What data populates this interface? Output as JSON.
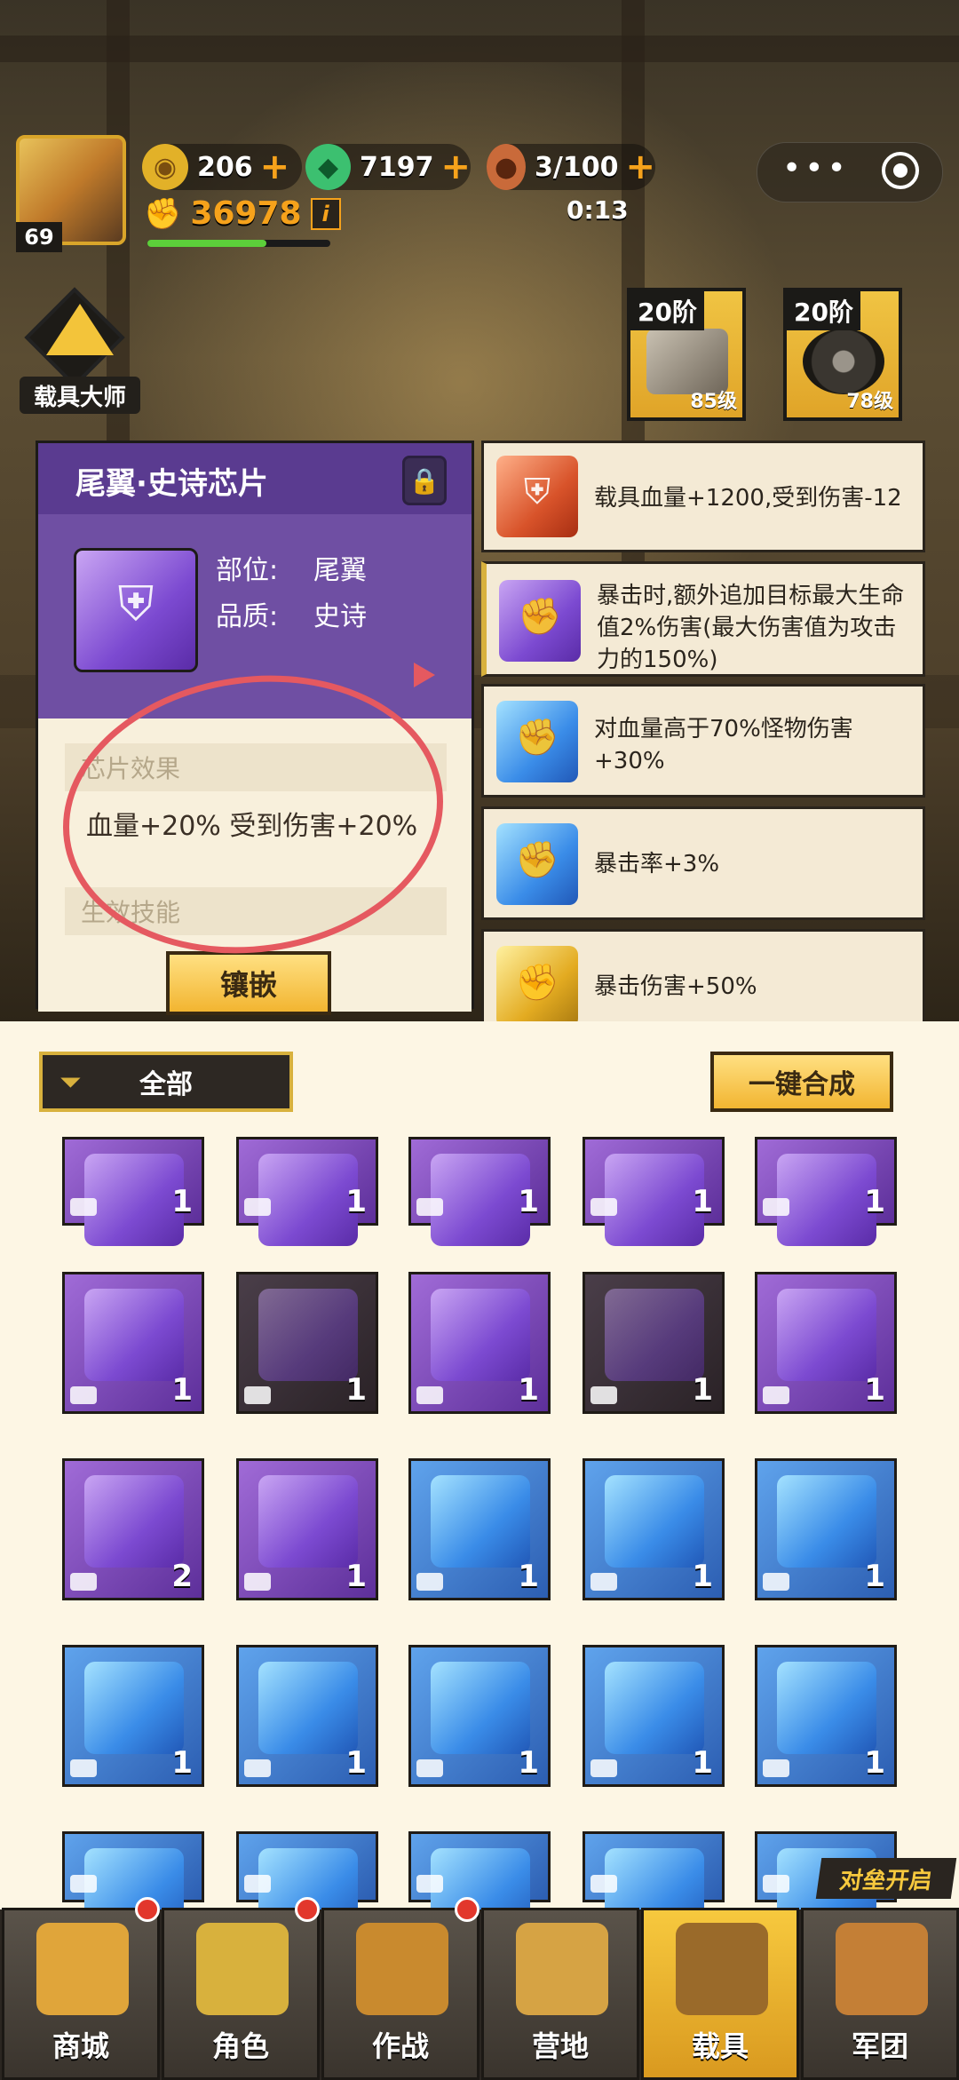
{
  "player": {
    "level": "69",
    "power": "36978",
    "power_info": "i",
    "xp_fraction": 0.65
  },
  "resources": {
    "coins": "206",
    "gems": "7197",
    "energy": "3/100",
    "energy_timer": "0:13"
  },
  "vehicle_master": {
    "label": "载具大师"
  },
  "parts": [
    {
      "tier": "20阶",
      "level": "85级",
      "name": "engine"
    },
    {
      "tier": "20阶",
      "level": "78级",
      "name": "wheel"
    }
  ],
  "detail": {
    "title": "尾翼·史诗芯片",
    "position_label": "部位:",
    "position_value": "尾翼",
    "quality_label": "品质:",
    "quality_value": "史诗",
    "effect_header": "芯片效果",
    "effect_text": "血量+20% 受到伤害+20%",
    "skill_header": "生效技能",
    "inlay_button": "镶嵌"
  },
  "skills": [
    {
      "text": "载具血量+1200,受到伤害-12",
      "color": "red"
    },
    {
      "text": "暴击时,额外追加目标最大生命值2%伤害(最大伤害值为攻击力的150%)",
      "color": "purple"
    },
    {
      "text": "对血量高于70%怪物伤害+30%",
      "color": "blue"
    },
    {
      "text": "暴击率+3%",
      "color": "blue"
    },
    {
      "text": "暴击伤害+50%",
      "color": "gold"
    }
  ],
  "inventory": {
    "filter_label": "全部",
    "merge_button": "一键合成",
    "rows": [
      [
        {
          "c": "1",
          "t": "p"
        },
        {
          "c": "1",
          "t": "p"
        },
        {
          "c": "1",
          "t": "p"
        },
        {
          "c": "1",
          "t": "p"
        },
        {
          "c": "1",
          "t": "p"
        }
      ],
      [
        {
          "c": "1",
          "t": "p"
        },
        {
          "c": "1",
          "t": "d"
        },
        {
          "c": "1",
          "t": "p"
        },
        {
          "c": "1",
          "t": "d"
        },
        {
          "c": "1",
          "t": "p"
        }
      ],
      [
        {
          "c": "2",
          "t": "p"
        },
        {
          "c": "1",
          "t": "p"
        },
        {
          "c": "1",
          "t": "b"
        },
        {
          "c": "1",
          "t": "b"
        },
        {
          "c": "1",
          "t": "b"
        }
      ],
      [
        {
          "c": "1",
          "t": "b"
        },
        {
          "c": "1",
          "t": "b"
        },
        {
          "c": "1",
          "t": "b"
        },
        {
          "c": "1",
          "t": "b"
        },
        {
          "c": "1",
          "t": "b"
        }
      ],
      [
        {
          "c": "",
          "t": "b"
        },
        {
          "c": "",
          "t": "b"
        },
        {
          "c": "",
          "t": "b"
        },
        {
          "c": "",
          "t": "b"
        },
        {
          "c": "",
          "t": "b"
        }
      ]
    ]
  },
  "event_banner": "对垒开启",
  "nav": [
    {
      "label": "商城",
      "icon": "cart-icon",
      "badge": true
    },
    {
      "label": "角色",
      "icon": "character-icon",
      "badge": true
    },
    {
      "label": "作战",
      "icon": "battle-icon",
      "badge": true
    },
    {
      "label": "营地",
      "icon": "camp-icon",
      "badge": false
    },
    {
      "label": "载具",
      "icon": "vehicle-icon",
      "badge": false,
      "active": true
    },
    {
      "label": "军团",
      "icon": "legion-icon",
      "badge": false
    }
  ]
}
